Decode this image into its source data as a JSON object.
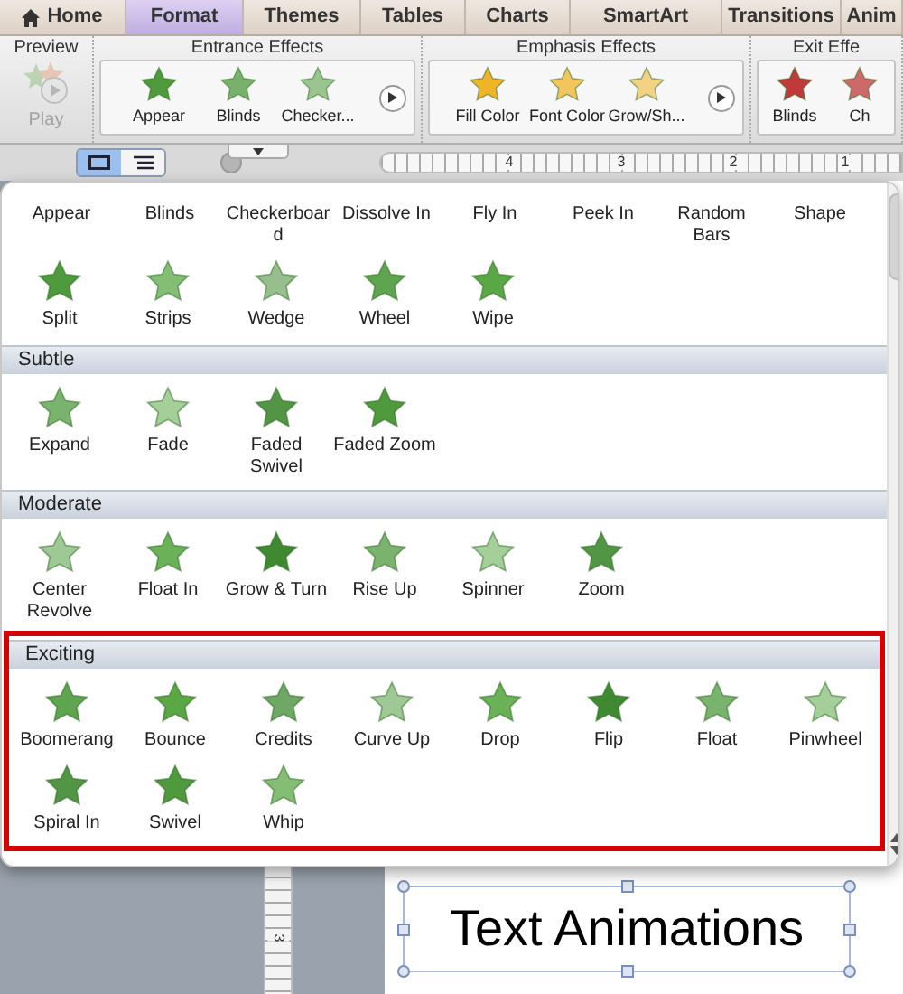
{
  "ribbon_tabs": [
    {
      "label": "Home",
      "kind": "home",
      "selected": false
    },
    {
      "label": "Format",
      "kind": "plain",
      "selected": true
    },
    {
      "label": "Themes",
      "kind": "plain",
      "selected": false
    },
    {
      "label": "Tables",
      "kind": "plain",
      "selected": false
    },
    {
      "label": "Charts",
      "kind": "plain",
      "selected": false
    },
    {
      "label": "SmartArt",
      "kind": "plain",
      "selected": false
    },
    {
      "label": "Transitions",
      "kind": "plain",
      "selected": false
    },
    {
      "label": "Anim",
      "kind": "plain",
      "selected": false
    }
  ],
  "ribbon_groups": [
    {
      "title": "Preview",
      "kind": "preview",
      "button": {
        "label": "Play",
        "disabled": true
      }
    },
    {
      "title": "Entrance Effects",
      "kind": "gallery",
      "color": "#4e9a3c",
      "items": [
        "Appear",
        "Blinds",
        "Checker..."
      ]
    },
    {
      "title": "Emphasis Effects",
      "kind": "gallery",
      "color": "#f0b429",
      "items": [
        "Fill Color",
        "Font Color",
        "Grow/Sh..."
      ]
    },
    {
      "title": "Exit Effe",
      "kind": "gallery",
      "color": "#c0393b",
      "items": [
        "Blinds",
        "Ch"
      ]
    }
  ],
  "view_buttons": [
    {
      "kind": "normal",
      "selected": true
    },
    {
      "kind": "outline",
      "selected": false
    }
  ],
  "ruler_numbers": [
    "4",
    "3",
    "2",
    "1"
  ],
  "effects_menu": {
    "scrolled_row": [
      "Appear",
      "Blinds",
      "Checkerboard",
      "Dissolve In",
      "Fly In",
      "Peek In",
      "Random Bars",
      "Shape"
    ],
    "sections": [
      {
        "items": [
          "Split",
          "Strips",
          "Wedge",
          "Wheel",
          "Wipe"
        ],
        "highlighted": false
      },
      {
        "title": "Subtle",
        "items": [
          "Expand",
          "Fade",
          "Faded Swivel",
          "Faded Zoom"
        ],
        "highlighted": false
      },
      {
        "title": "Moderate",
        "items": [
          "Center Revolve",
          "Float In",
          "Grow & Turn",
          "Rise Up",
          "Spinner",
          "Zoom"
        ],
        "highlighted": false
      },
      {
        "title": "Exciting",
        "items": [
          "Boomerang",
          "Bounce",
          "Credits",
          "Curve Up",
          "Drop",
          "Flip",
          "Float",
          "Pinwheel",
          "Spiral In",
          "Swivel",
          "Whip"
        ],
        "highlighted": true
      }
    ]
  },
  "vertical_ruler_number": "3",
  "slide_text": "Text Animations"
}
